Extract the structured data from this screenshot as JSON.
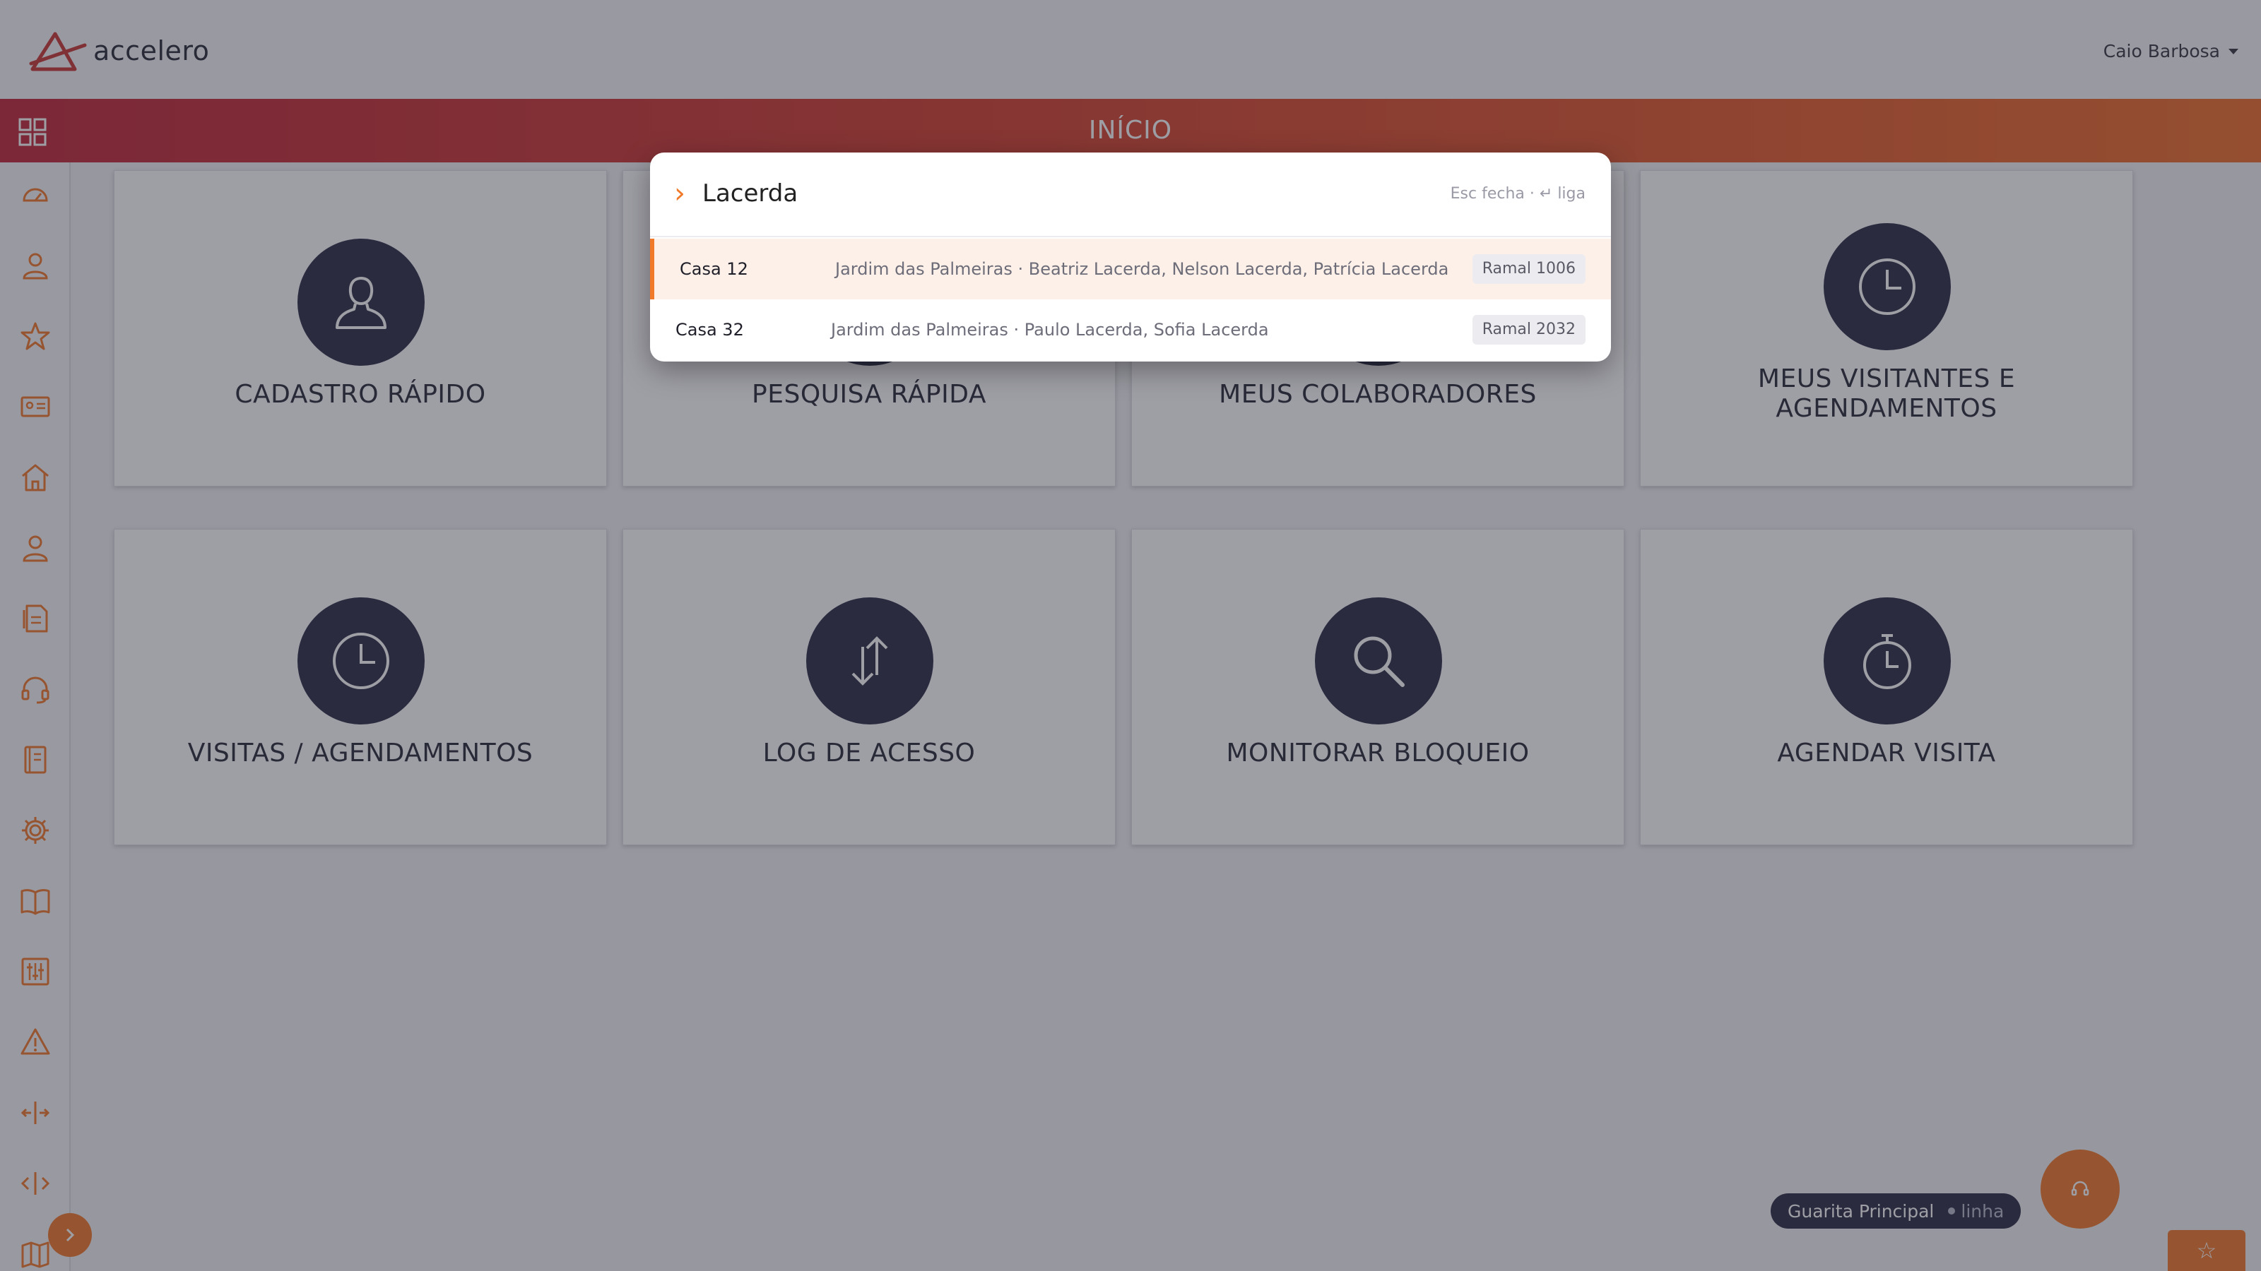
{
  "app": {
    "logo_text": "accelero"
  },
  "header": {
    "user_name": "Caio Barbosa"
  },
  "titlebar": {
    "title": "INÍCIO"
  },
  "sidebar": {
    "icons": [
      "dashboard-icon",
      "user-icon",
      "star-icon",
      "id-card-icon",
      "home-icon",
      "person-icon",
      "documents-icon",
      "headset-icon",
      "notebook-icon",
      "gear-icon",
      "book-icon",
      "sliders-icon",
      "warning-icon",
      "split-horizontal-icon",
      "code-icon",
      "map-icon"
    ]
  },
  "cards": [
    {
      "label": "CADASTRO RÁPIDO",
      "icon": "user-bust-icon"
    },
    {
      "label": "PESQUISA RÁPIDA",
      "icon": "search-icon"
    },
    {
      "label": "MEUS COLABORADORES",
      "icon": "people-icon"
    },
    {
      "label": "MEUS VISITANTES E AGENDAMENTOS",
      "icon": "clock-icon"
    },
    {
      "label": "VISITAS / AGENDAMENTOS",
      "icon": "clock-icon"
    },
    {
      "label": "LOG DE ACESSO",
      "icon": "arrows-updown-icon"
    },
    {
      "label": "MONITORAR BLOQUEIO",
      "icon": "search-icon"
    },
    {
      "label": "AGENDAR VISITA",
      "icon": "stopwatch-icon"
    }
  ],
  "palette": {
    "query": "Lacerda",
    "hint": "Esc fecha · ↵ liga",
    "results": [
      {
        "name": "Casa 12",
        "description": "Jardim das Palmeiras · Beatriz Lacerda, Nelson Lacerda, Patrícia Lacerda",
        "badge": "Ramal 1006"
      },
      {
        "name": "Casa 32",
        "description": "Jardim das Palmeiras · Paulo Lacerda, Sofia Lacerda",
        "badge": "Ramal 2032"
      }
    ]
  },
  "status": {
    "location": "Guarita Principal",
    "state": "linha"
  },
  "colors": {
    "accent": "#f07a2a",
    "dark": "#2d2f45",
    "gradient_start": "#c1283a",
    "gradient_end": "#ee6f2a"
  }
}
